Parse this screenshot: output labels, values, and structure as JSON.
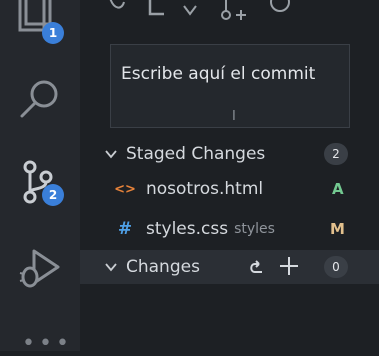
{
  "activity_bar": {
    "explorer_badge": "1",
    "scm_badge": "2"
  },
  "commit": {
    "placeholder": "Escribe aquí el commit"
  },
  "staged": {
    "label": "Staged Changes",
    "count": "2",
    "files": [
      {
        "icon": "<>",
        "icon_color": "#e8833a",
        "name": "nosotros.html",
        "dir": "",
        "status": "A",
        "status_color": "#73c991"
      },
      {
        "icon": "#",
        "icon_color": "#4fa0e6",
        "name": "styles.css",
        "dir": "styles",
        "status": "M",
        "status_color": "#e2c08d"
      }
    ]
  },
  "changes": {
    "label": "Changes",
    "count": "0"
  },
  "colors": {
    "accent": "#3a7fd9",
    "background": "#1d2024",
    "activity_bar": "#25282d"
  }
}
